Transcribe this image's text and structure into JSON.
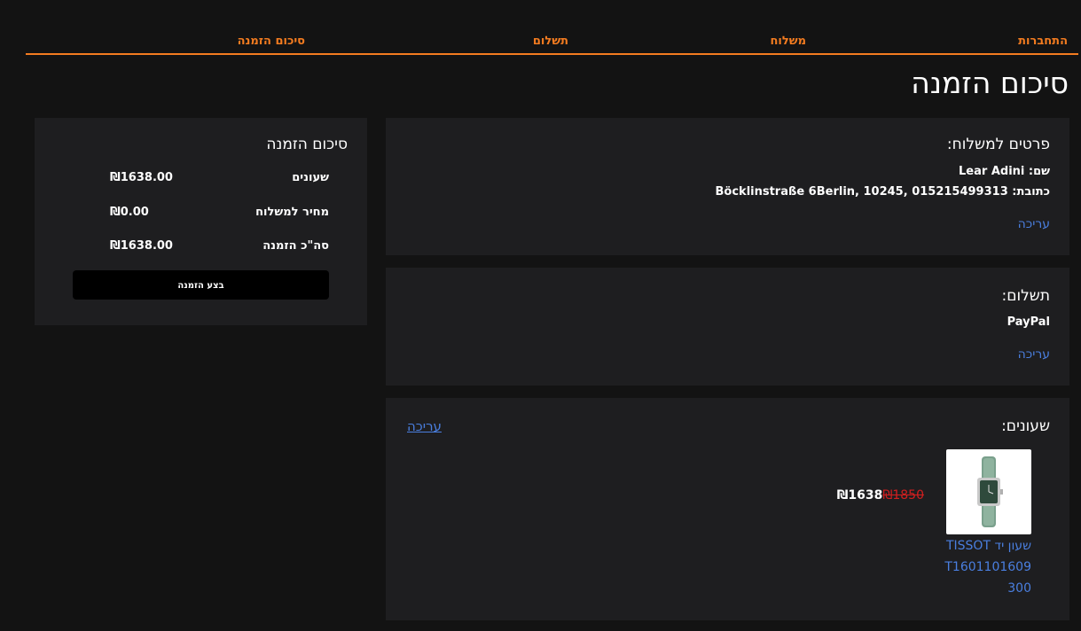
{
  "steps": [
    "התחברות",
    "משלוח",
    "תשלום",
    "סיכום הזמנה"
  ],
  "colors": {
    "accent": "#f47c20",
    "link": "#4a7fe0",
    "old_price": "#d11f1f",
    "panel": "#1e1e20",
    "background": "#131313"
  },
  "page_title": "סיכום הזמנה",
  "shipping": {
    "heading": "פרטים למשלוח:",
    "name_line": "שם: Lear Adini",
    "address_line": "כתובת: Böcklinstraße 6Berlin, 10245,  015215499313",
    "edit_label": "עריכה"
  },
  "payment": {
    "heading": "תשלום:",
    "method": "PayPal",
    "edit_label": "עריכה"
  },
  "products": {
    "heading": "שעונים:",
    "edit_label": "עריכה",
    "items": [
      {
        "name": "שעון יד TISSOT T1601101609300",
        "price": "₪1638",
        "old_price": "₪1850",
        "image_icon": "wristwatch-icon"
      }
    ]
  },
  "summary": {
    "heading": "סיכום הזמנה",
    "rows": [
      {
        "label": "שעונים",
        "value": "₪1638.00"
      },
      {
        "label": "מחיר למשלוח",
        "value": "₪0.00"
      },
      {
        "label": "סה\"כ הזמנה",
        "value": "₪1638.00"
      }
    ],
    "button_label": "בצע הזמנה"
  }
}
